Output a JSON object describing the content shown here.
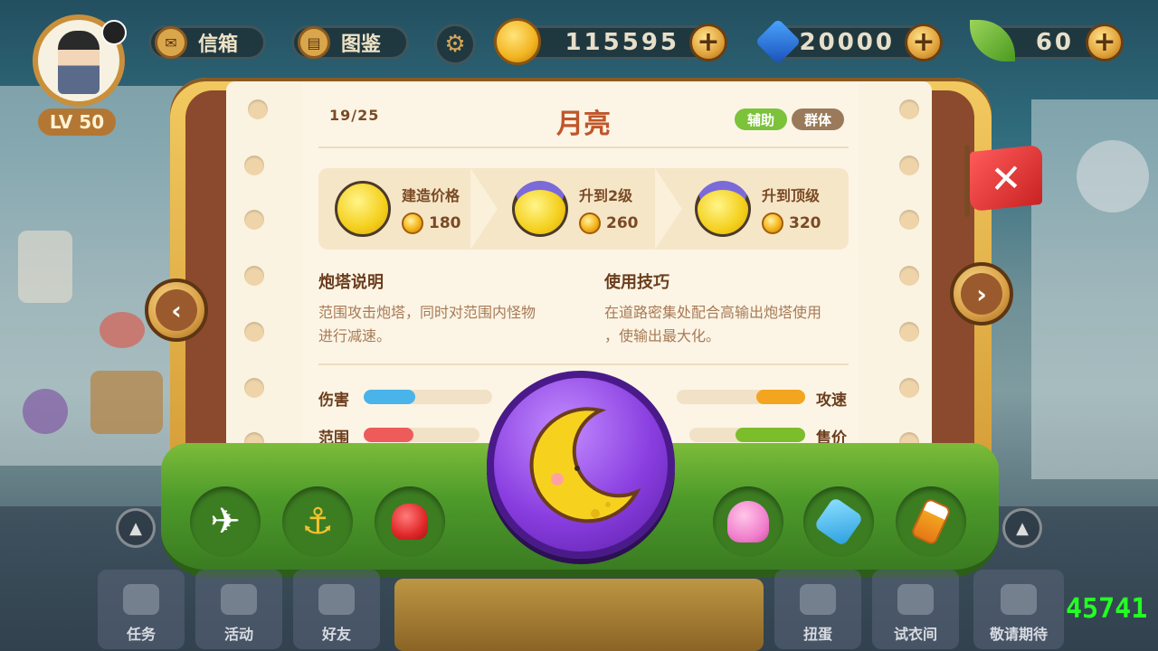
{
  "topbar": {
    "level": "LV 50",
    "mail_label": "信箱",
    "codex_label": "图鉴",
    "gold": "115595",
    "gems": "20000",
    "leaves": "60"
  },
  "tower": {
    "index": "19/25",
    "name": "月亮",
    "tags": [
      "辅助",
      "群体"
    ],
    "costs": [
      {
        "label": "建造价格",
        "value": "180"
      },
      {
        "label": "升到2级",
        "value": "260"
      },
      {
        "label": "升到顶级",
        "value": "320"
      }
    ],
    "desc_title": "炮塔说明",
    "desc_text_1": "范围攻击炮塔，同时对范围内怪物",
    "desc_text_2": "进行减速。",
    "tips_title": "使用技巧",
    "tips_text_1": "在道路密集处配合高输出炮塔使用",
    "tips_text_2": "，使输出最大化。",
    "stats": {
      "damage": {
        "label": "伤害",
        "fraction": 0.4
      },
      "range": {
        "label": "范围",
        "fraction": 0.43
      },
      "attack_speed": {
        "label": "攻速",
        "fraction": 0.38
      },
      "price": {
        "label": "售价",
        "fraction": 0.6
      }
    }
  },
  "tray_icons": [
    "airplane-icon",
    "anchor-icon",
    "boxing-glove-icon",
    "moon-icon",
    "octopus-icon",
    "fan-icon",
    "bottle-icon"
  ],
  "bottom_nav": [
    "任务",
    "活动",
    "好友",
    "扭蛋",
    "试衣间",
    "敬请期待"
  ],
  "counter": "45741",
  "colors": {
    "damage": "#49b3ea",
    "range": "#ee5b5b",
    "attack_speed": "#f3a51f",
    "price": "#7cbd2c",
    "tag_support": "#7cc23a",
    "tag_group": "#9a7a5a"
  }
}
